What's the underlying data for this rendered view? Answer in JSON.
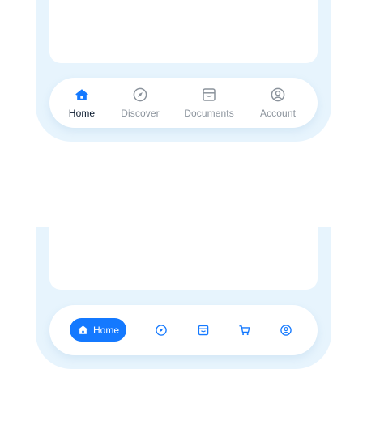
{
  "colors": {
    "accent": "#1479ff",
    "inactive": "#8b939c",
    "frame": "#e7f4fd",
    "active_text": "#0b1a2e"
  },
  "labeled_nav": {
    "items": [
      {
        "label": "Home",
        "icon": "home-icon",
        "active": true
      },
      {
        "label": "Discover",
        "icon": "compass-icon",
        "active": false
      },
      {
        "label": "Documents",
        "icon": "archive-box-icon",
        "active": false
      },
      {
        "label": "Account",
        "icon": "user-circle-icon",
        "active": false
      }
    ]
  },
  "compact_nav": {
    "active_label": "Home",
    "items": [
      {
        "icon": "home-icon",
        "active": true
      },
      {
        "icon": "compass-icon",
        "active": false
      },
      {
        "icon": "archive-box-icon",
        "active": false
      },
      {
        "icon": "cart-icon",
        "active": false
      },
      {
        "icon": "user-circle-icon",
        "active": false
      }
    ]
  }
}
